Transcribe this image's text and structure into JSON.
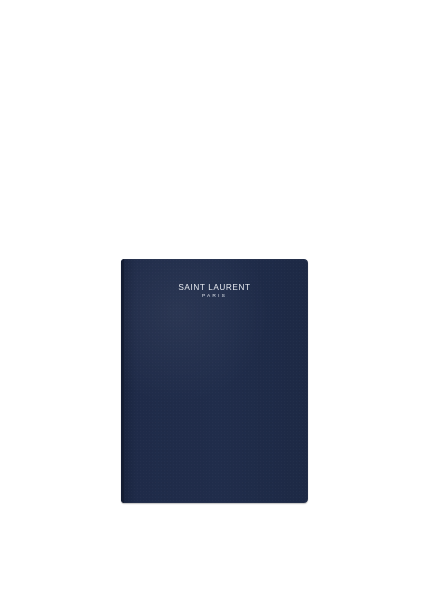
{
  "image": {
    "subject": "navy wallet",
    "background_color": "#ffffff",
    "object_color": "#202d4b",
    "logo_color": "#e8ebf2"
  },
  "logo": {
    "brand": "SAINT LAURENT",
    "city": "PARIS"
  }
}
